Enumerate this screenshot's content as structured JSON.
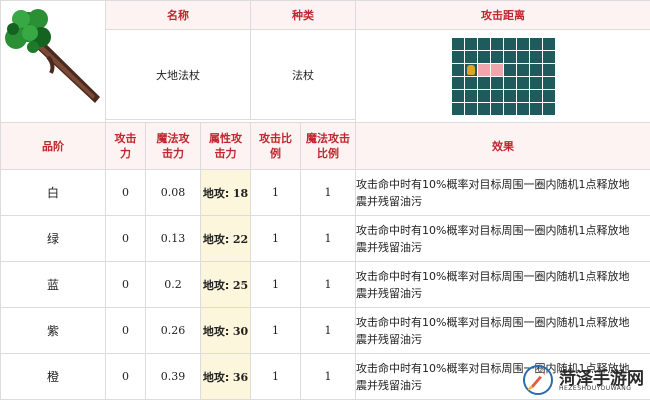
{
  "header": {
    "name_label": "名称",
    "type_label": "种类",
    "range_label": "攻击距离"
  },
  "item": {
    "name": "大地法杖",
    "type": "法杖",
    "icon": "earth-staff-icon"
  },
  "range_grid": {
    "cols": 8,
    "rows": 6,
    "self": [
      1,
      2
    ],
    "targets": [
      [
        2,
        2
      ],
      [
        3,
        2
      ]
    ],
    "color_empty": "#1f5a5c",
    "color_target": "#f1a6ae"
  },
  "columns": {
    "grade": "品阶",
    "attack_line1": "攻击",
    "attack_line2": "力",
    "magic_line1": "魔法攻",
    "magic_line2": "击力",
    "attr_line1": "属性攻",
    "attr_line2": "击力",
    "atk_ratio_line1": "攻击比",
    "atk_ratio_line2": "例",
    "magic_ratio_line1": "魔法攻击",
    "magic_ratio_line2": "比例",
    "effect": "效果"
  },
  "rows": [
    {
      "grade": "白",
      "attack": "0",
      "magic": "0.08",
      "attr_label": "地攻:",
      "attr_value": "18",
      "atk_ratio": "1",
      "magic_ratio": "1",
      "effect_line1": "攻击命中时有10%概率对目标周围一圈内随机1点释放地",
      "effect_line2": "震并残留油污"
    },
    {
      "grade": "绿",
      "attack": "0",
      "magic": "0.13",
      "attr_label": "地攻:",
      "attr_value": "22",
      "atk_ratio": "1",
      "magic_ratio": "1",
      "effect_line1": "攻击命中时有10%概率对目标周围一圈内随机1点释放地",
      "effect_line2": "震并残留油污"
    },
    {
      "grade": "蓝",
      "attack": "0",
      "magic": "0.2",
      "attr_label": "地攻:",
      "attr_value": "25",
      "atk_ratio": "1",
      "magic_ratio": "1",
      "effect_line1": "攻击命中时有10%概率对目标周围一圈内随机1点释放地",
      "effect_line2": "震并残留油污"
    },
    {
      "grade": "紫",
      "attack": "0",
      "magic": "0.26",
      "attr_label": "地攻:",
      "attr_value": "30",
      "atk_ratio": "1",
      "magic_ratio": "1",
      "effect_line1": "攻击命中时有10%概率对目标周围一圈内随机1点释放地",
      "effect_line2": "震并残留油污"
    },
    {
      "grade": "橙",
      "attack": "0",
      "magic": "0.39",
      "attr_label": "地攻:",
      "attr_value": "36",
      "atk_ratio": "1",
      "magic_ratio": "1",
      "effect_line1": "攻击命中时有10%概率对目标周围一圈内随机1点释放地",
      "effect_line2": "震并残留油污"
    }
  ],
  "watermark": {
    "title": "菏泽手游网",
    "subtitle": "HEZESHOUYOUWANG",
    "icon": "rocket-logo-icon"
  }
}
